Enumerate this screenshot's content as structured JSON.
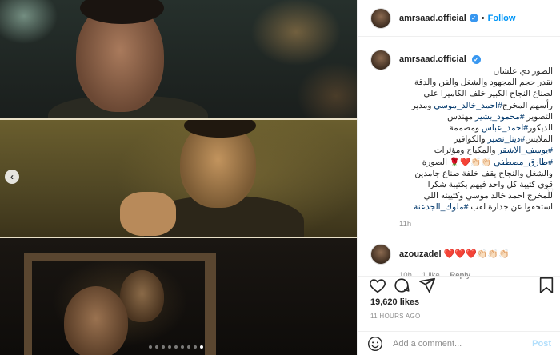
{
  "header": {
    "username": "amrsaad.official",
    "separator": "•",
    "follow_label": "Follow"
  },
  "caption": {
    "username": "amrsaad.official",
    "lines": [
      {
        "parts": [
          {
            "text": "الصور دي علشان",
            "link": false
          }
        ]
      },
      {
        "parts": [
          {
            "text": "نقدر حجم المجهود والشغل والفن والدقة",
            "link": false
          }
        ]
      },
      {
        "parts": [
          {
            "text": "لصناع النجاح الكبير خلف الكاميرا علي",
            "link": false
          }
        ]
      },
      {
        "parts": [
          {
            "text": "رأسهم المخرج",
            "link": false
          },
          {
            "text": "#احمد_خالد_موسي",
            "link": true
          },
          {
            "text": " ومدير",
            "link": false
          }
        ]
      },
      {
        "parts": [
          {
            "text": "التصوير ",
            "link": false
          },
          {
            "text": "#محمود_بشير",
            "link": true
          },
          {
            "text": " مهندس",
            "link": false
          }
        ]
      },
      {
        "parts": [
          {
            "text": "الديكور",
            "link": false
          },
          {
            "text": "#احمد_عباس",
            "link": true
          },
          {
            "text": " ومصممة",
            "link": false
          }
        ]
      },
      {
        "parts": [
          {
            "text": "الملابس",
            "link": false
          },
          {
            "text": "#دينا_نصير",
            "link": true
          },
          {
            "text": " والكوافير",
            "link": false
          }
        ]
      },
      {
        "parts": [
          {
            "text": "#يوسف_الاشقر",
            "link": true
          },
          {
            "text": " والمكياج ومؤثرات",
            "link": false
          }
        ]
      },
      {
        "parts": [
          {
            "text": "#طارق_مصطفي",
            "link": true
          },
          {
            "text": " 👏🏻👏🏻❤️🌹 الصورة",
            "link": false
          }
        ]
      },
      {
        "parts": [
          {
            "text": "والشغل والنجاح يقف خلفة صناع جامدين",
            "link": false
          }
        ]
      },
      {
        "parts": [
          {
            "text": "قوي كتيبة كل واحد فيهم بكتيبة شكرا",
            "link": false
          }
        ]
      },
      {
        "parts": [
          {
            "text": "للمخرج احمد خالد موسي وكتيبته اللي",
            "link": false
          }
        ]
      },
      {
        "parts": [
          {
            "text": "استحقوا عن جدارة لقب ",
            "link": false
          },
          {
            "text": "#ملوك_الجدعنة",
            "link": true
          }
        ]
      }
    ],
    "time": "11h"
  },
  "comment": {
    "username": "azouzadel",
    "text": "❤️❤️❤️👏🏻👏🏻👏🏻",
    "time": "10h",
    "likes": "1 like",
    "reply": "Reply"
  },
  "likes_count": "19,620 likes",
  "posted_ago": "11 HOURS AGO",
  "add_comment": {
    "placeholder": "Add a comment...",
    "post_label": "Post"
  },
  "carousel": {
    "dot_count": 9,
    "active_index": 8,
    "prev_arrow": "‹"
  },
  "icons": {
    "like": "heart-icon",
    "comment": "comment-icon",
    "share": "share-icon",
    "save": "bookmark-icon",
    "emoji": "emoji-icon",
    "verified": "verified-badge-icon"
  },
  "colors": {
    "link": "#00376b",
    "follow": "#0095f6",
    "verified": "#3897f0",
    "muted": "#8e8e8e"
  }
}
